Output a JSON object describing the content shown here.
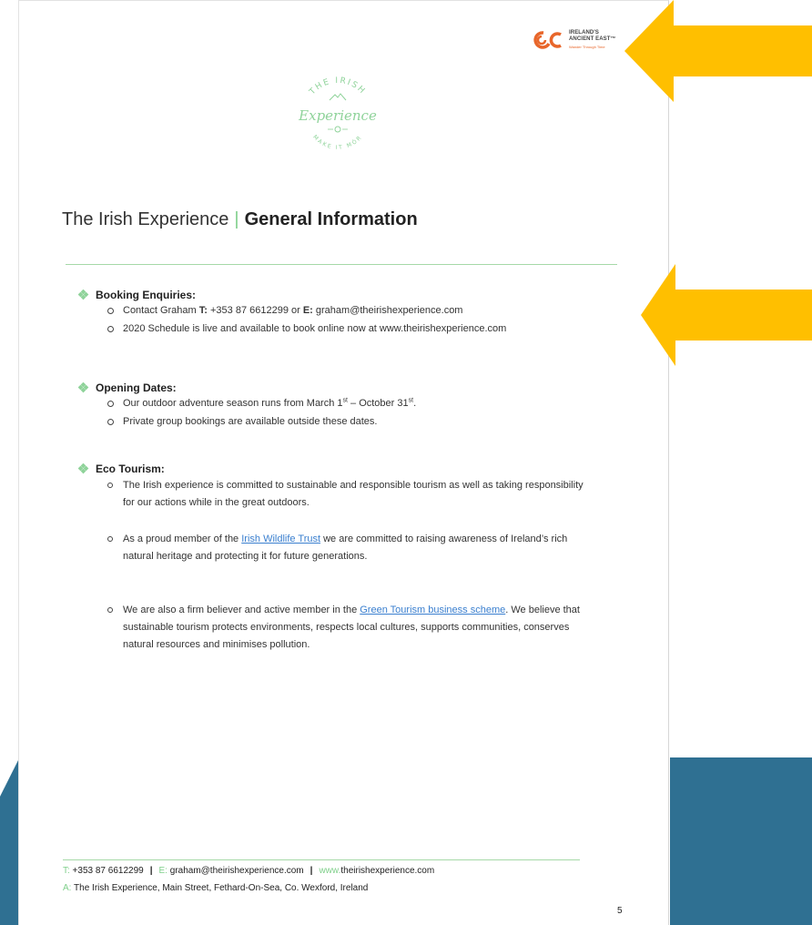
{
  "partner_logo": {
    "line1": "IRELAND'S",
    "line2": "ANCIENT EAST™",
    "line3": "Wander Through Time"
  },
  "brand_logo": {
    "top": "THE IRISH",
    "script": "Experience",
    "bottom": "MAKE IT MÓR"
  },
  "title": {
    "prefix": "The Irish Experience",
    "separator": "|",
    "strong": "General Information"
  },
  "sections": {
    "booking": {
      "heading": "Booking Enquiries:",
      "item1": {
        "pre": "Contact Graham ",
        "t_label": "T:",
        "phone": " +353 87 6612299 or ",
        "e_label": "E:",
        "email": " graham@theirishexperience.com"
      },
      "item2": "2020 Schedule is live and available to book online now at www.theirishexperience.com"
    },
    "opening": {
      "heading": "Opening Dates:",
      "item1": {
        "pre": "Our outdoor adventure season runs from March 1",
        "sup1": "st",
        "mid": " – October 31",
        "sup2": "st",
        "post": "."
      },
      "item2": " Private group bookings are available outside these dates."
    },
    "eco": {
      "heading": "Eco Tourism:",
      "item1": "The Irish experience is committed to sustainable and responsible tourism as well as taking responsibility for our actions while in the great outdoors.",
      "item2": {
        "pre": "As a proud member of the ",
        "link": "Irish Wildlife Trust",
        "post": " we are committed to raising awareness of Ireland’s rich natural heritage and protecting it for future generations."
      },
      "item3": {
        "pre": "We are also a firm believer and active member in the ",
        "link": "Green Tourism business scheme",
        "post": ". We believe that sustainable tourism protects environments, respects local cultures, supports communities, conserves natural resources and minimises pollution."
      }
    }
  },
  "footer": {
    "t_label": "T:",
    "phone": " +353 87 6612299",
    "pipe": "|",
    "e_label": "E:",
    "email": " graham@theirishexperience.com",
    "w_label": "www.",
    "web": "theirishexperience.com",
    "a_label": "A:",
    "company": " The Irish Experience,",
    "address": " Main Street, Fethard-On-Sea, Co. Wexford, Ireland"
  },
  "page_number": "5",
  "colors": {
    "arrow": "#ffbf00",
    "accent_green": "#7fcf8a",
    "background_blue": "#2f7092",
    "link": "#3a7fcf",
    "partner_orange": "#e8662a"
  }
}
